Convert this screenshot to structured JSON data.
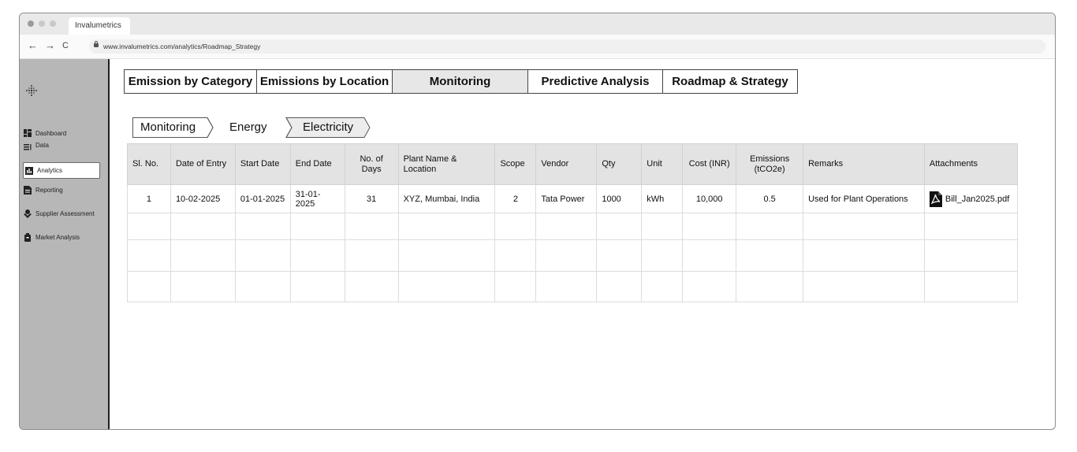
{
  "browser": {
    "tab_title": "Invalumetrics",
    "url": "www.invalumetrics.com/analytics/Roadmap_Strategy",
    "back_icon": "←",
    "forward_icon": "→",
    "reload_icon": "C"
  },
  "sidebar": {
    "items": [
      {
        "label": "Dashboard",
        "icon": "dashboard-icon"
      },
      {
        "label": "Data",
        "icon": "data-icon"
      },
      {
        "label": "Analytics",
        "icon": "analytics-icon"
      },
      {
        "label": "Reporting",
        "icon": "reporting-icon"
      },
      {
        "label": "Supplier Assessment",
        "icon": "supplier-icon"
      },
      {
        "label": "Market Analysis",
        "icon": "market-icon"
      }
    ],
    "active": "Analytics"
  },
  "tabs": [
    {
      "label": "Emission by Category"
    },
    {
      "label": "Emissions by Location"
    },
    {
      "label": "Monitoring"
    },
    {
      "label": "Predictive Analysis"
    },
    {
      "label": "Roadmap & Strategy"
    }
  ],
  "active_tab": "Monitoring",
  "breadcrumb": [
    "Monitoring",
    "Energy",
    "Electricity"
  ],
  "table": {
    "headers": [
      "Sl. No.",
      "Date of Entry",
      "Start Date",
      "End Date",
      "No. of Days",
      "Plant Name & Location",
      "Scope",
      "Vendor",
      "Qty",
      "Unit",
      "Cost (INR)",
      "Emissions (tCO2e)",
      "Remarks",
      "Attachments"
    ],
    "rows": [
      [
        "1",
        "10-02-2025",
        "01-01-2025",
        "31-01-2025",
        "31",
        "XYZ, Mumbai, India",
        "2",
        "Tata Power",
        "1000",
        "kWh",
        "10,000",
        "0.5",
        "Used for Plant Operations",
        "Bill_Jan2025.pdf"
      ]
    ]
  },
  "colors": {
    "sidebar_bg": "#b7b7b7",
    "active_tab_bg": "#e7e7e7",
    "table_header_bg": "#e3e3e3"
  }
}
